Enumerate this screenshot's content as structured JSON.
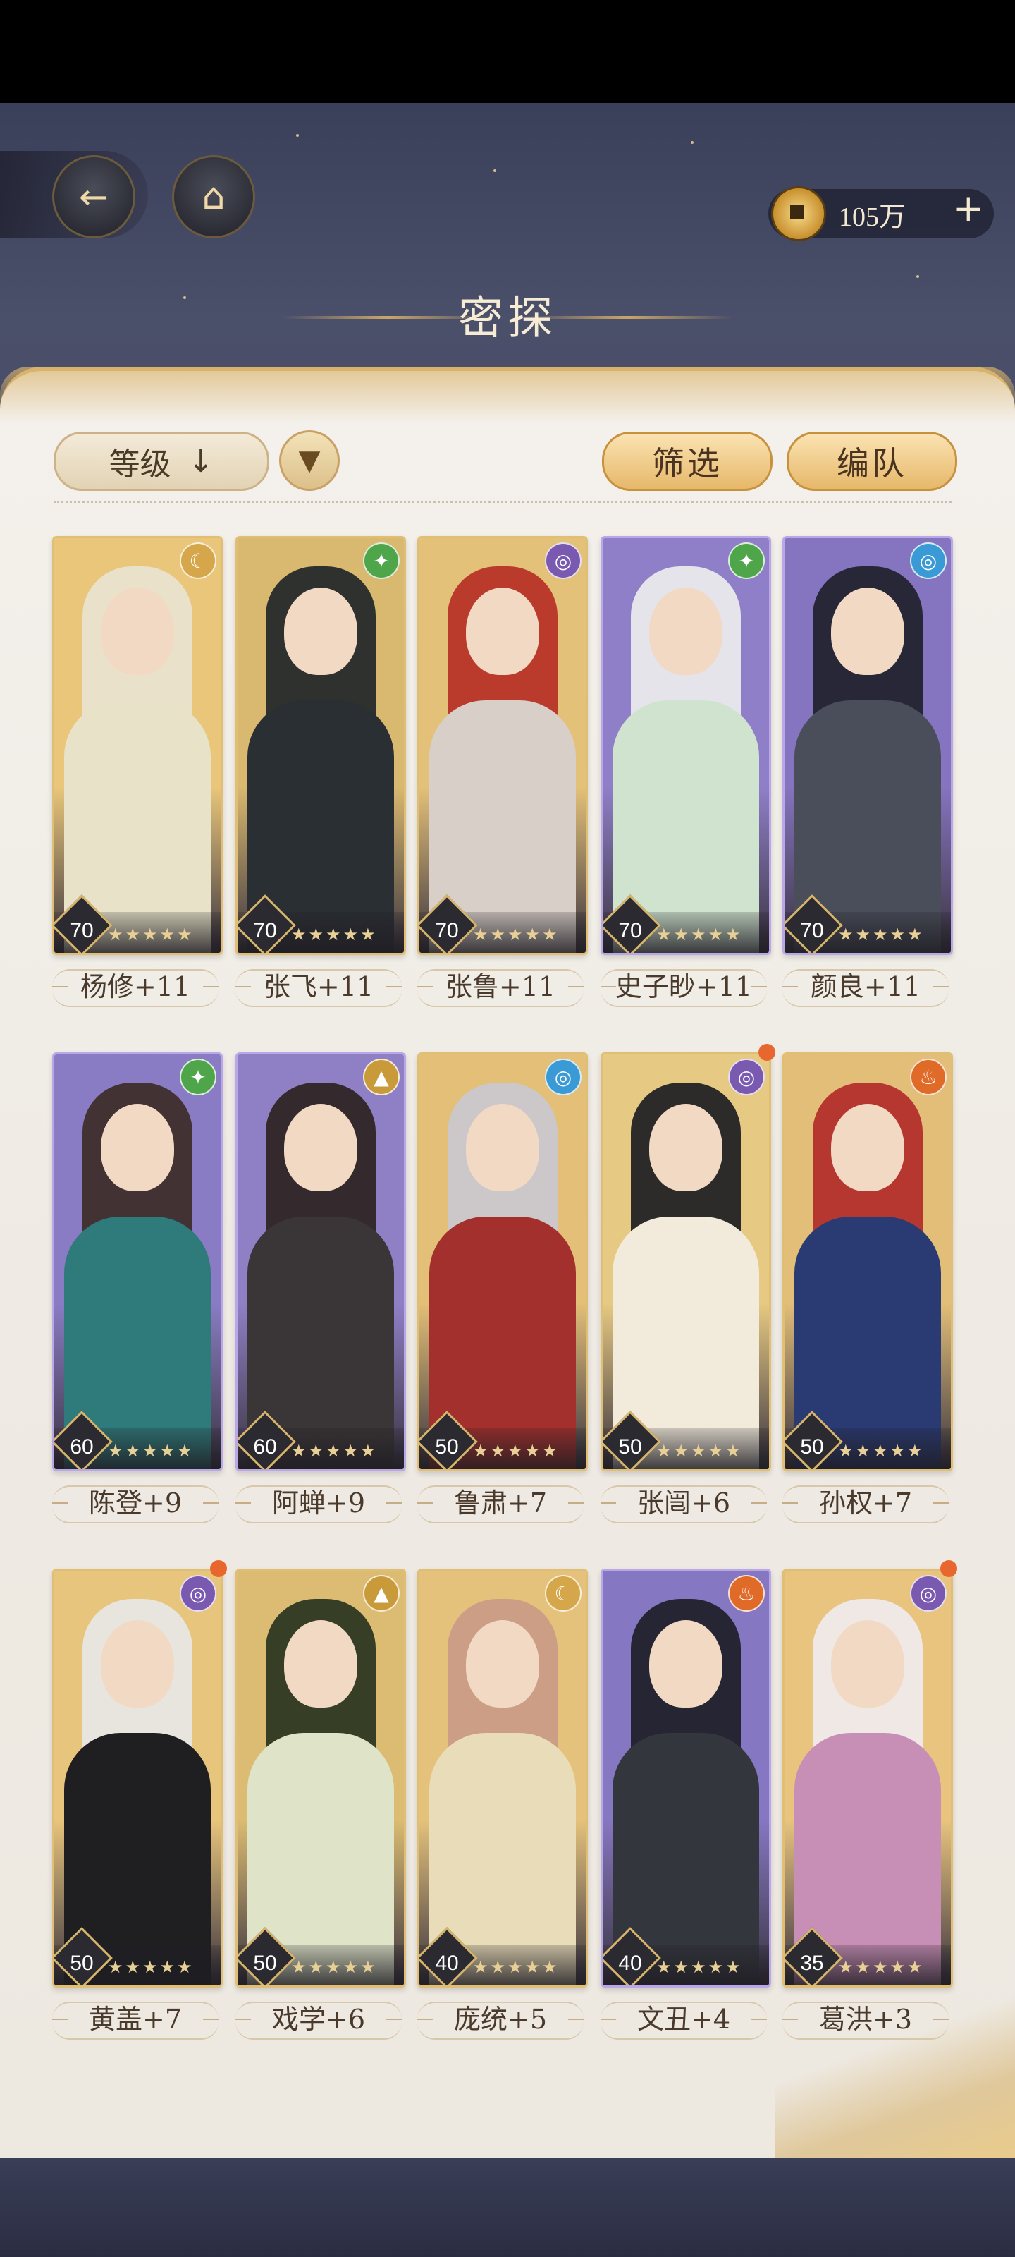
{
  "header": {
    "title": "密探",
    "currency": {
      "value": "105万",
      "icon": "coin-icon",
      "add_label": "+"
    },
    "back_icon": "back-arrow-icon",
    "pavilion_icon": "pavilion-icon"
  },
  "toolbar": {
    "sort_label": "等级",
    "sort_arrow": "↓",
    "sort_dir_icon": "dropdown-icon",
    "filter_label": "筛选",
    "team_label": "编队"
  },
  "colors": {
    "panel_bg": "#f1ede6",
    "gold": "#d6b46c",
    "button_gold": "#e6b86a",
    "text_dark": "#4a3a2c",
    "bg_dark": "#3a3f5a"
  },
  "characters": [
    {
      "name": "杨修+11",
      "level": "70",
      "element": "moon",
      "stars": "★★★★★",
      "frame": "gold",
      "dot": false,
      "hair": "#e9e3d2",
      "robe": "#e8e3c8",
      "bg": "#e9c67a"
    },
    {
      "name": "张飞+11",
      "level": "70",
      "element": "leaf",
      "stars": "★★★★★",
      "frame": "gold",
      "dot": false,
      "hair": "#1c2228",
      "robe": "#2a2f33",
      "bg": "#d9b86f"
    },
    {
      "name": "张鲁+11",
      "level": "70",
      "element": "swirl-purple",
      "stars": "★★★★★",
      "frame": "gold",
      "dot": false,
      "hair": "#b52b24",
      "robe": "#d8cfc8",
      "bg": "#e4c179"
    },
    {
      "name": "史子眇+11",
      "level": "70",
      "element": "leaf",
      "stars": "★★★★★",
      "frame": "purple",
      "dot": false,
      "hair": "#eef0ee",
      "robe": "#cfe3cf",
      "bg": "#8f7fc8"
    },
    {
      "name": "颜良+11",
      "level": "70",
      "element": "water",
      "stars": "★★★★★",
      "frame": "purple",
      "dot": false,
      "hair": "#1e1f28",
      "robe": "#4a4e5a",
      "bg": "#8574bf"
    },
    {
      "name": "陈登+9",
      "level": "60",
      "element": "leaf",
      "stars": "★★★★★",
      "frame": "purple",
      "dot": false,
      "hair": "#3a2a24",
      "robe": "#2f7a7a",
      "bg": "#8a7cc4"
    },
    {
      "name": "阿蝉+9",
      "level": "60",
      "element": "mountain",
      "stars": "★★★★★",
      "frame": "purple",
      "dot": false,
      "hair": "#2a201c",
      "robe": "#3a3536",
      "bg": "#8f80c6"
    },
    {
      "name": "鲁肃+7",
      "level": "50",
      "element": "water",
      "stars": "★★★★★",
      "frame": "gold",
      "dot": false,
      "hair": "#c9c9d2",
      "robe": "#a3302c",
      "bg": "#e3bf77"
    },
    {
      "name": "张闿+6",
      "level": "50",
      "element": "swirl-purple",
      "stars": "★★★★★",
      "frame": "gold",
      "dot": true,
      "hair": "#181a20",
      "robe": "#f2ebdc",
      "bg": "#e6c982"
    },
    {
      "name": "孙权+7",
      "level": "50",
      "element": "fire",
      "stars": "★★★★★",
      "frame": "gold",
      "dot": false,
      "hair": "#b02828",
      "robe": "#2a3a72",
      "bg": "#e2be78"
    },
    {
      "name": "黄盖+7",
      "level": "50",
      "element": "swirl-purple",
      "stars": "★★★★★",
      "frame": "gold",
      "dot": true,
      "hair": "#e8e8ea",
      "robe": "#1f1f22",
      "bg": "#e8c57c"
    },
    {
      "name": "戏学+6",
      "level": "50",
      "element": "mountain",
      "stars": "★★★★★",
      "frame": "gold",
      "dot": false,
      "hair": "#24301e",
      "robe": "#dfe4c8",
      "bg": "#dcbc72"
    },
    {
      "name": "庞统+5",
      "level": "40",
      "element": "moon",
      "stars": "★★★★★",
      "frame": "gold",
      "dot": false,
      "hair": "#c99a86",
      "robe": "#e9dcb8",
      "bg": "#e5c27c"
    },
    {
      "name": "文丑+4",
      "level": "40",
      "element": "fire",
      "stars": "★★★★★",
      "frame": "purple",
      "dot": false,
      "hair": "#1c1c24",
      "robe": "#34363e",
      "bg": "#8677c2"
    },
    {
      "name": "葛洪+3",
      "level": "35",
      "element": "swirl-purple",
      "stars": "★★★★★",
      "frame": "gold",
      "dot": true,
      "hair": "#f0ecf0",
      "robe": "#c88fb6",
      "bg": "#e8c47e"
    }
  ]
}
